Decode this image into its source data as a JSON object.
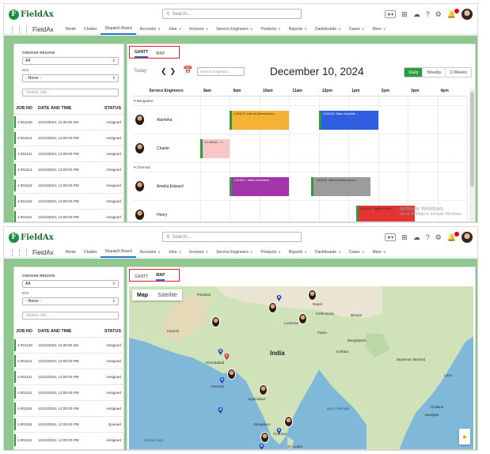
{
  "brand": {
    "name": "FieldAx",
    "app_name": "FieldAx"
  },
  "search": {
    "placeholder": "Search..."
  },
  "nav": {
    "items": [
      {
        "label": "Home",
        "dropdown": false
      },
      {
        "label": "Chatter",
        "dropdown": false
      },
      {
        "label": "Dispatch Board",
        "dropdown": false,
        "active": true
      },
      {
        "label": "Accounts",
        "dropdown": true
      },
      {
        "label": "Jobs",
        "dropdown": true
      },
      {
        "label": "Invoices",
        "dropdown": true
      },
      {
        "label": "Service Engineers",
        "dropdown": true
      },
      {
        "label": "Products",
        "dropdown": true
      },
      {
        "label": "Reports",
        "dropdown": true
      },
      {
        "label": "Dashboards",
        "dropdown": true
      },
      {
        "label": "Cases",
        "dropdown": true
      },
      {
        "label": "More",
        "dropdown": true
      }
    ]
  },
  "filters": {
    "region_label": "CHOOSE REGION",
    "region_value": "All",
    "kits_label": "Kits",
    "kits_value": "- None -",
    "search_job_placeholder": "Search Job..."
  },
  "jobs": {
    "headers": [
      "JOB NO",
      "DATE AND TIME",
      "STATUS"
    ],
    "rows_gantt": [
      [
        "J-001128",
        "12/10/2024, 11:00:00 AM",
        "Assigned"
      ],
      [
        "J-001113",
        "12/10/2024, 12:00:00 PM",
        "Assigned"
      ],
      [
        "J-001121",
        "12/10/2024, 12:00:00 PM",
        "Assigned"
      ],
      [
        "J-001114",
        "12/10/2024, 12:00:00 PM",
        "Assigned"
      ],
      [
        "J-001119",
        "12/10/2024, 12:00:00 PM",
        "Assigned"
      ],
      [
        "J-001118",
        "12/10/2024, 12:00:00 PM",
        "Assigned"
      ],
      [
        "J-001112",
        "12/10/2024, 12:00:00 PM",
        "Assigned"
      ]
    ],
    "rows_map": [
      [
        "J-001128",
        "12/10/2024, 11:00:00 AM",
        "Assigned"
      ],
      [
        "J-001113",
        "12/10/2024, 12:00:00 PM",
        "Assigned"
      ],
      [
        "J-001121",
        "12/10/2024, 12:00:00 PM",
        "Assigned"
      ],
      [
        "J-001114",
        "12/10/2024, 12:00:00 PM",
        "Assigned"
      ],
      [
        "J-001119",
        "12/10/2024, 12:00:00 PM",
        "Assigned"
      ],
      [
        "J-001118",
        "12/10/2024, 12:00:00 PM",
        "Queued"
      ],
      [
        "J-001112",
        "12/10/2024, 12:00:00 PM",
        "Assigned"
      ]
    ]
  },
  "view_tabs": {
    "gantt": "GANTT",
    "map": "MAP"
  },
  "gantt": {
    "today_label": "Today",
    "engineer_search_placeholder": "Search Engineer...",
    "date_title": "December 10, 2024",
    "view_buttons": [
      "Daily",
      "Weekly",
      "2-Weeks"
    ],
    "active_view": "Daily",
    "engineer_col_header": "Service Engineers",
    "hours": [
      "8am",
      "9am",
      "10am",
      "11am",
      "12pm",
      "1pm",
      "2pm",
      "3pm",
      "4pm"
    ],
    "groups": [
      {
        "region": "Bangalore",
        "engineers": [
          {
            "name": "Alamitha",
            "jobs": [
              {
                "label": "J-001173 -Call out (Demo Accou...",
                "start": 9.0,
                "end": 11.0,
                "color": "#f5b335"
              },
              {
                "label": "J-001116 -Tasks Complete...",
                "start": 12.0,
                "end": 14.0,
                "color": "#2f5fe0"
              }
            ]
          },
          {
            "name": "Charlie",
            "jobs": [
              {
                "label": "J-1-001121 - T...",
                "start": 8.0,
                "end": 9.0,
                "color": "#f7c6c6"
              }
            ]
          }
        ]
      },
      {
        "region": "Chennai",
        "engineers": [
          {
            "name": "Amelia Edward",
            "jobs": [
              {
                "label": "J-001119 - Tasks Summaries",
                "start": 9.0,
                "end": 11.0,
                "color": "#a335a8"
              },
              {
                "label": "J-001120 -Call out (Demo Accou...",
                "start": 11.75,
                "end": 13.75,
                "color": "#9c9c9c"
              }
            ]
          },
          {
            "name": "Henry",
            "jobs": [
              {
                "label": "J-001173 - Tamil & Plant &...",
                "start": 13.25,
                "end": 15.25,
                "color": "#e33434"
              }
            ]
          }
        ]
      },
      {
        "region": "Delhi",
        "engineers": []
      }
    ]
  },
  "map": {
    "toggle": [
      "Map",
      "Satellite"
    ],
    "active_toggle": "Map",
    "labels": {
      "country": "India",
      "pakistan": "Pakistan",
      "nepal": "Nepal",
      "bhutan": "Bhutan",
      "bangladesh": "Bangladesh",
      "myanmar": "Myanmar (Burma)",
      "laos": "Laos",
      "thailand": "Thailand",
      "sri_lanka": "Sri Lanka",
      "karachi": "Karachi",
      "ahmedabad": "Ahmedabad",
      "mumbai": "Mumbai",
      "hyderabad": "Hyderabad",
      "bengaluru": "Bengaluru",
      "chennai": "Chennai",
      "kolkata": "Kolkata",
      "kathmandu": "Kathmandu",
      "lucknow": "Lucknow",
      "patna": "Patna",
      "bangkok": "Bangkok",
      "bay_of_bengal": "Bay of Bengal",
      "arabian_sea": "Arabian Sea"
    }
  },
  "watermark": {
    "line1": "Activate Windows",
    "line2": "Go to Settings to activate Windows."
  },
  "colors": {
    "brand_green": "#1a8f3c",
    "accent_blue": "#2b6fd1",
    "highlight_red": "#d22222",
    "assigned_green": "#2e9b3c"
  }
}
